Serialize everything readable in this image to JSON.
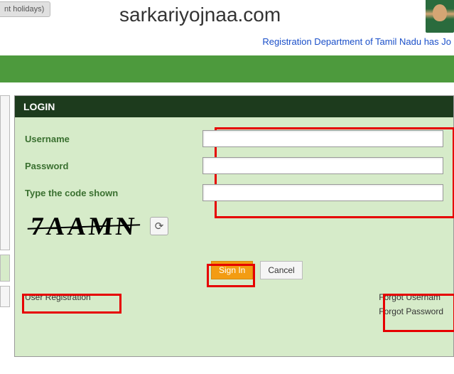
{
  "header": {
    "holidays_btn": "nt holidays)",
    "watermark": "sarkariyojnaa.com"
  },
  "marquee": {
    "text": "Registration Department of Tamil Nadu has Jo"
  },
  "login": {
    "title": "LOGIN",
    "username_label": "Username",
    "password_label": "Password",
    "captcha_label": "Type the code shown",
    "captcha_code": "7AAMN",
    "signin_label": "Sign In",
    "cancel_label": "Cancel",
    "user_reg_link": "User Registration",
    "forgot_user_link": "Forgot Usernam",
    "forgot_pass_link": "Forgot Password"
  }
}
